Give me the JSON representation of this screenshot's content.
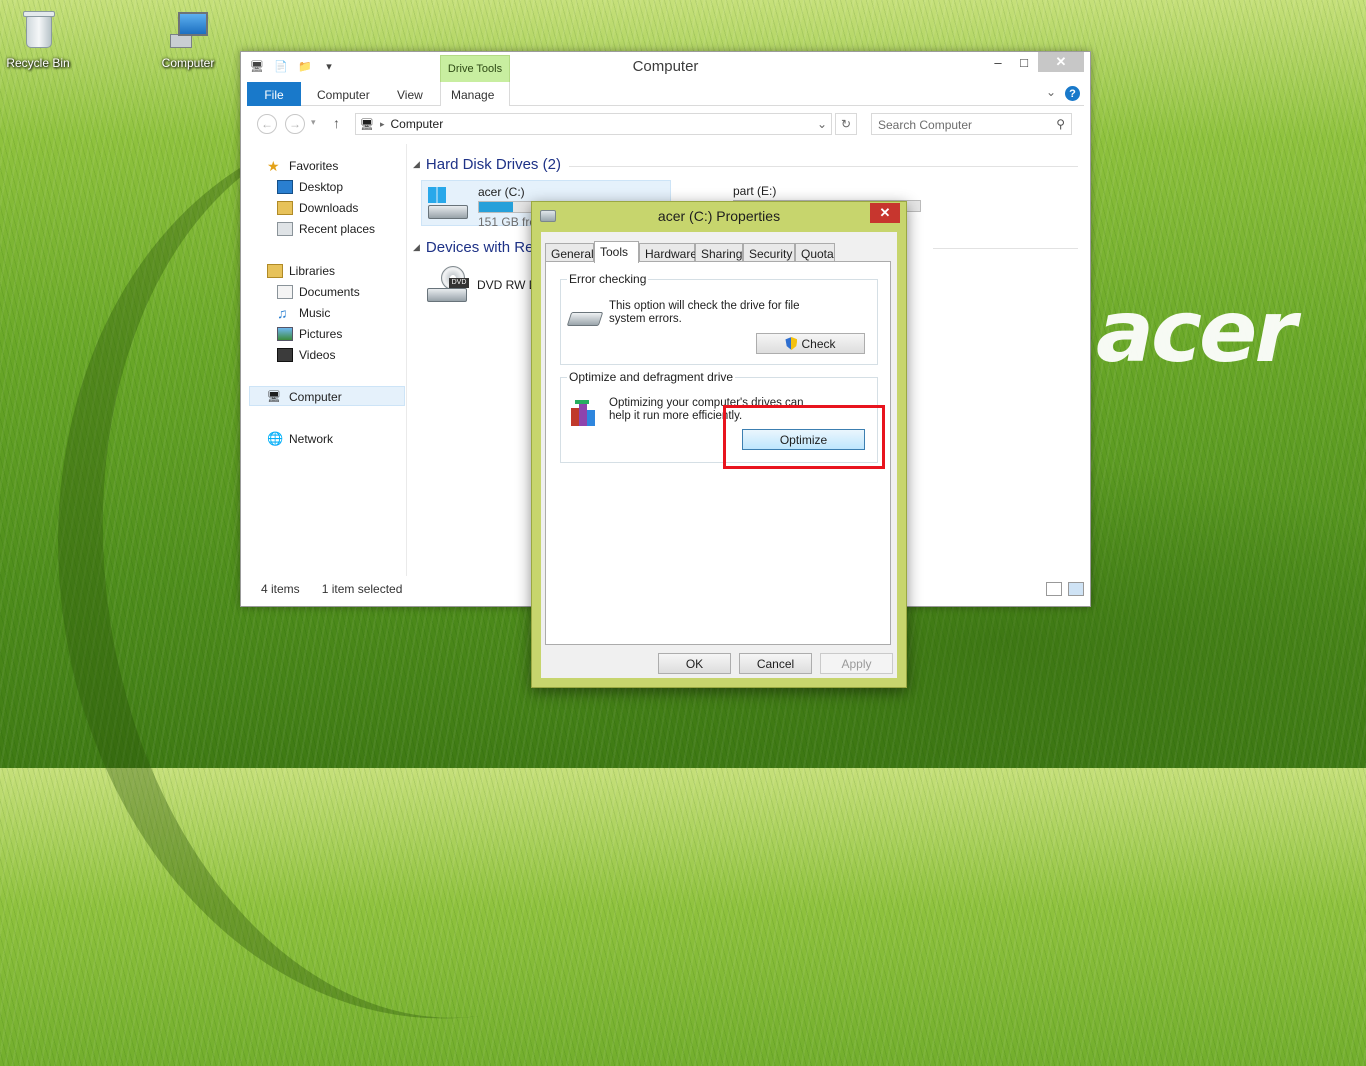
{
  "desktop": {
    "icons": [
      {
        "label": "Recycle Bin",
        "icon": "recycle-bin-icon"
      },
      {
        "label": "Computer",
        "icon": "computer-icon"
      }
    ],
    "wallpaper_logo": "acer"
  },
  "explorer": {
    "title": "Computer",
    "contextual_tab": "Drive Tools",
    "ribbon_tabs": [
      "File",
      "Computer",
      "View",
      "Manage"
    ],
    "address": "Computer",
    "search_placeholder": "Search Computer",
    "nav": {
      "favorites": "Favorites",
      "desktop": "Desktop",
      "downloads": "Downloads",
      "recent": "Recent places",
      "libraries": "Libraries",
      "documents": "Documents",
      "music": "Music",
      "pictures": "Pictures",
      "videos": "Videos",
      "computer": "Computer",
      "network": "Network"
    },
    "groups": {
      "hdd": "Hard Disk Drives (2)",
      "devices": "Devices with Re"
    },
    "drives": {
      "c_name": "acer (C:)",
      "c_free": "151 GB fre",
      "c_used_fraction": 0.18,
      "e_name": "part (E:)",
      "dvd_name": "DVD RW D"
    },
    "status": {
      "items": "4 items",
      "selected": "1 item selected"
    }
  },
  "dialog": {
    "title": "acer (C:) Properties",
    "tabs": [
      "General",
      "Tools",
      "Hardware",
      "Sharing",
      "Security",
      "Quota"
    ],
    "active_tab": "Tools",
    "error_checking": {
      "label": "Error checking",
      "text": "This option will check the drive for file system errors.",
      "button": "Check"
    },
    "optimize": {
      "label": "Optimize and defragment drive",
      "text": "Optimizing your computer's drives can help it run more efficiently.",
      "button": "Optimize"
    },
    "buttons": {
      "ok": "OK",
      "cancel": "Cancel",
      "apply": "Apply"
    }
  },
  "colors": {
    "highlight": "#e8141e",
    "dialog_frame": "#c7d56d",
    "file_tab": "#1979ca",
    "drive_tools": "#c8eea0"
  }
}
